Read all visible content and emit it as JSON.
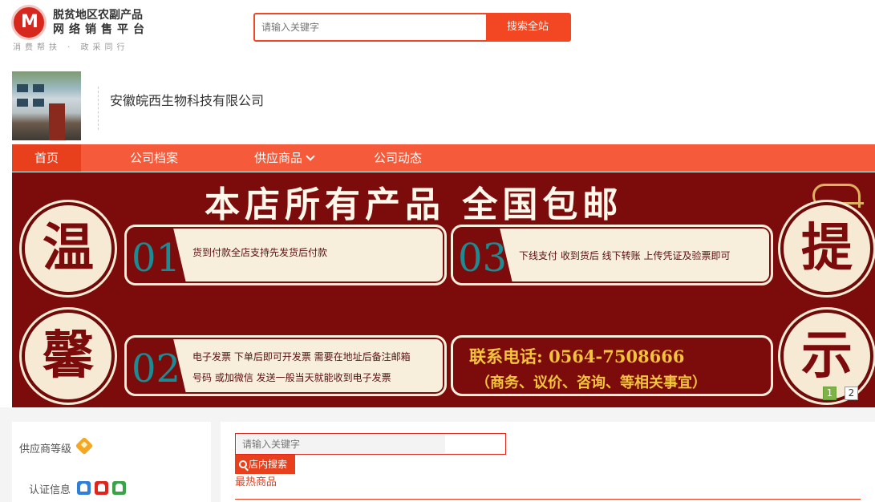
{
  "site": {
    "logo_glyph": "M",
    "title_line1": "脱贫地区农副产品",
    "title_line2": "网络销售平台",
    "slogan": "消费帮扶 · 政采同行"
  },
  "top_search": {
    "placeholder": "请输入关键字",
    "button_label": "搜索全站"
  },
  "company": {
    "name": "安徽皖西生物科技有限公司"
  },
  "nav": {
    "items": [
      {
        "label": "首页",
        "active": true
      },
      {
        "label": "公司档案"
      },
      {
        "label": "供应商品"
      },
      {
        "label": "公司动态"
      }
    ]
  },
  "banner": {
    "title": "本店所有产品  全国包邮",
    "circles": [
      "温",
      "馨",
      "提",
      "示"
    ],
    "cards": [
      {
        "num": "01",
        "lines": [
          "货到付款全店支持先发货后付款"
        ]
      },
      {
        "num": "03",
        "lines": [
          "下线支付 收到货后 线下转账 上传凭证及验票即可"
        ]
      },
      {
        "num": "02",
        "lines": [
          "电子发票  下单后即可开发票  需要在地址后备注邮箱",
          "号码  或加微信  发送一般当天就能收到电子发票"
        ]
      }
    ],
    "phone_line": "联系电话: 0564-7508666",
    "phone_sub": "（商务、议价、咨询、等相关事宜）",
    "pager": [
      "1",
      "2"
    ]
  },
  "sidebar": {
    "level_label": "供应商等级",
    "cert_label": "认证信息"
  },
  "shop": {
    "search_placeholder": "请输入关键字",
    "search_button": "店内搜索",
    "hot_label": "最热商品"
  },
  "colors": {
    "brand_red": "#f24722",
    "nav_bg": "#f55a3a",
    "banner_bg": "#7c0c0c",
    "accent_teal": "#1c8c94",
    "accent_gold": "#f2c33b"
  }
}
